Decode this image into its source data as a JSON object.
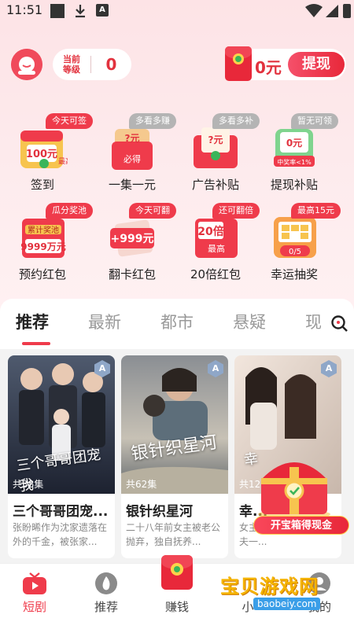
{
  "status_bar": {
    "time": "11:51"
  },
  "header": {
    "level_label": "当前\n等级",
    "level_value": "0",
    "balance": "0元",
    "withdraw_label": "提现"
  },
  "tasks": [
    {
      "label": "签到",
      "badge": "今天可签",
      "badge_style": "red",
      "icon_text": "100元",
      "icon_sub": "最高"
    },
    {
      "label": "一集一元",
      "badge": "多看多赚",
      "badge_style": "gray",
      "icon_text": "?元",
      "icon_sub": "必得"
    },
    {
      "label": "广告补贴",
      "badge": "多看多补",
      "badge_style": "gray",
      "icon_text": "?元",
      "icon_sub": ""
    },
    {
      "label": "提现补贴",
      "badge": "暂无可领",
      "badge_style": "gray",
      "icon_text": "0元",
      "icon_sub": "中奖率<1%"
    },
    {
      "label": "预约红包",
      "badge": "瓜分奖池",
      "badge_style": "red",
      "icon_text": "9999万元",
      "icon_sub": "累计奖池"
    },
    {
      "label": "翻卡红包",
      "badge": "今天可翻",
      "badge_style": "red",
      "icon_text": "+999元",
      "icon_sub": ""
    },
    {
      "label": "20倍红包",
      "badge": "还可翻倍",
      "badge_style": "red",
      "icon_text": "20倍",
      "icon_sub": "最高"
    },
    {
      "label": "幸运抽奖",
      "badge": "最高15元",
      "badge_style": "red",
      "icon_text": "0/5",
      "icon_sub": ""
    }
  ],
  "tabs": [
    "推荐",
    "最新",
    "都市",
    "悬疑",
    "现"
  ],
  "dramas": [
    {
      "title": "三个哥哥团宠...",
      "episodes": "共38集",
      "desc": "张盼晞作为沈家遗落在外的千金，被张家...",
      "art": "三个哥哥团宠我"
    },
    {
      "title": "银针织星河",
      "episodes": "共62集",
      "desc": "二十八年前女主被老公抛弃，独自抚养...",
      "art": "银针织星河"
    },
    {
      "title": "幸...",
      "episodes": "共12",
      "desc": "女主...全心全力伺候前夫一...",
      "art": "幸"
    }
  ],
  "treasure": {
    "label": "开宝箱得现金"
  },
  "bottom_nav": [
    {
      "label": "短剧",
      "active": true
    },
    {
      "label": "推荐",
      "active": false
    },
    {
      "label": "赚钱",
      "active": false
    },
    {
      "label": "小",
      "active": false
    },
    {
      "label": "我的",
      "active": false
    }
  ],
  "watermark": {
    "title": "宝贝游戏网",
    "url": "baobeiy.com"
  },
  "colors": {
    "accent": "#ef3b4b",
    "brand_red": "#e8283a",
    "gold": "#ffd24a"
  }
}
